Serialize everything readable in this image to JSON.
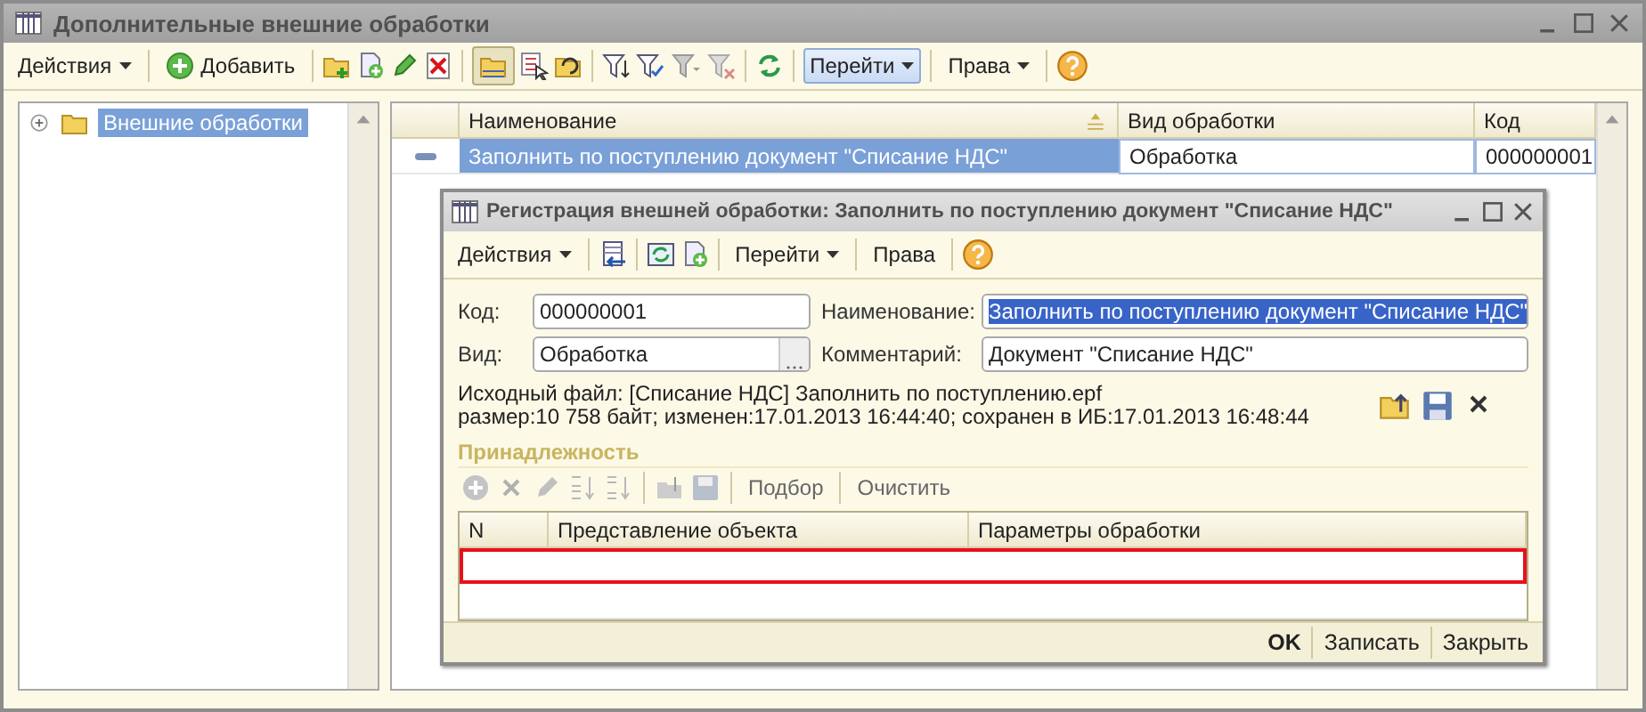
{
  "window": {
    "title": "Дополнительные внешние обработки"
  },
  "toolbar": {
    "actions_menu": "Действия",
    "add_button": "Добавить",
    "list_view_pressed": true,
    "goto_menu": "Перейти",
    "goto_hovered": true,
    "rights_menu": "Права"
  },
  "tree": {
    "items": [
      {
        "label": "Внешние обработки",
        "expanded": false,
        "selected": true
      }
    ]
  },
  "table": {
    "columns": [
      "Наименование",
      "Вид обработки",
      "Код"
    ],
    "rows": [
      {
        "cells": [
          "Заполнить по поступлению документ \"Списание НДС\"",
          "Обработка",
          "000000001"
        ],
        "selected": true
      }
    ]
  },
  "dialog": {
    "title": "Регистрация внешней обработки: Заполнить по поступлению документ \"Списание НДС\"",
    "toolbar": {
      "actions_menu": "Действия",
      "goto_menu": "Перейти",
      "rights_button": "Права"
    },
    "fields": [
      {
        "label": "Код:",
        "value": "000000001",
        "kind": "text",
        "selected_text": false
      },
      {
        "label": "Наименование:",
        "value": "Заполнить по поступлению документ \"Списание НДС\"",
        "kind": "text",
        "selected_text": true
      },
      {
        "label": "Вид:",
        "value": "Обработка",
        "kind": "choice",
        "selected_text": false
      },
      {
        "label": "Комментарий:",
        "value": "Документ \"Списание НДС\"",
        "kind": "text",
        "selected_text": false
      }
    ],
    "file_info": [
      "Исходный файл: [Списание НДС] Заполнить по поступлению.epf",
      "размер:10 758 байт; изменен:17.01.2013 16:44:40; сохранен в ИБ:17.01.2013 16:48:44"
    ],
    "group": {
      "label": "Принадлежность",
      "disabled": true
    },
    "subtoolbar": {
      "icons_disabled": true,
      "buttons": [
        "Подбор",
        "Очистить"
      ]
    },
    "table": {
      "columns": [
        "N",
        "Представление объекта",
        "Параметры обработки"
      ],
      "rows": [
        {
          "current": true
        },
        {
          "current": false
        }
      ]
    },
    "buttons": [
      {
        "label": "OK",
        "default": true
      },
      {
        "label": "Записать",
        "default": false
      },
      {
        "label": "Закрыть",
        "default": false
      }
    ]
  }
}
